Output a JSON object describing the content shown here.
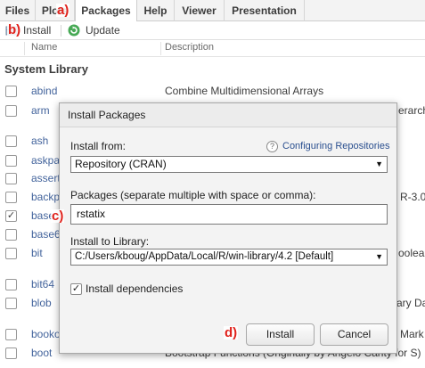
{
  "tabs": [
    "Files",
    "Plots",
    "Packages",
    "Help",
    "Viewer",
    "Presentation"
  ],
  "toolbar": {
    "install_label": "Install",
    "update_label": "Update"
  },
  "columns": {
    "name": "Name",
    "description": "Description"
  },
  "section_title": "System Library",
  "packages": [
    {
      "name": "abind",
      "description": "Combine Multidimensional Arrays",
      "checked": false
    },
    {
      "name": "arm",
      "description": "",
      "edge": "erarch",
      "checked": false
    },
    {
      "name": "ash",
      "description": "",
      "edge": "",
      "checked": false
    },
    {
      "name": "askpa",
      "description": "",
      "edge": "",
      "checked": false
    },
    {
      "name": "assert",
      "description": "",
      "edge": "",
      "checked": false
    },
    {
      "name": "backp",
      "description": "",
      "edge": "R-3.0",
      "checked": false
    },
    {
      "name": "base",
      "description": "",
      "edge": "",
      "checked": true
    },
    {
      "name": "base6",
      "description": "",
      "edge": "",
      "checked": false
    },
    {
      "name": "bit",
      "description": "",
      "edge": "oolear",
      "checked": false
    },
    {
      "name": "bit64",
      "description": "",
      "edge": "",
      "checked": false
    },
    {
      "name": "blob",
      "description": "",
      "edge": "ary Da",
      "checked": false
    },
    {
      "name": "booko",
      "description": "",
      "edge": "Mark",
      "checked": false
    },
    {
      "name": "boot",
      "description": "Bootstrap Functions (Originally by Angelo Canty for S)",
      "edge": "",
      "checked": false
    }
  ],
  "dialog": {
    "title": "Install Packages",
    "install_from_label": "Install from:",
    "configuring_link": "Configuring Repositories",
    "install_from_value": "Repository (CRAN)",
    "packages_label": "Packages (separate multiple with space or comma):",
    "packages_value": "rstatix",
    "library_label": "Install to Library:",
    "library_value": "C:/Users/kboug/AppData/Local/R/win-library/4.2 [Default]",
    "install_deps_label": "Install dependencies",
    "install_deps_checked": true,
    "install_button": "Install",
    "cancel_button": "Cancel"
  },
  "annotations": {
    "a": "a)",
    "b": "b)",
    "c": "c)",
    "d": "d)"
  },
  "colors": {
    "annotation": "#e0211b",
    "link": "#2a4f8f",
    "update_icon": "#2e9e3e"
  },
  "icons": {
    "install": "package-install-icon",
    "update": "update-icon",
    "help": "help-icon"
  }
}
